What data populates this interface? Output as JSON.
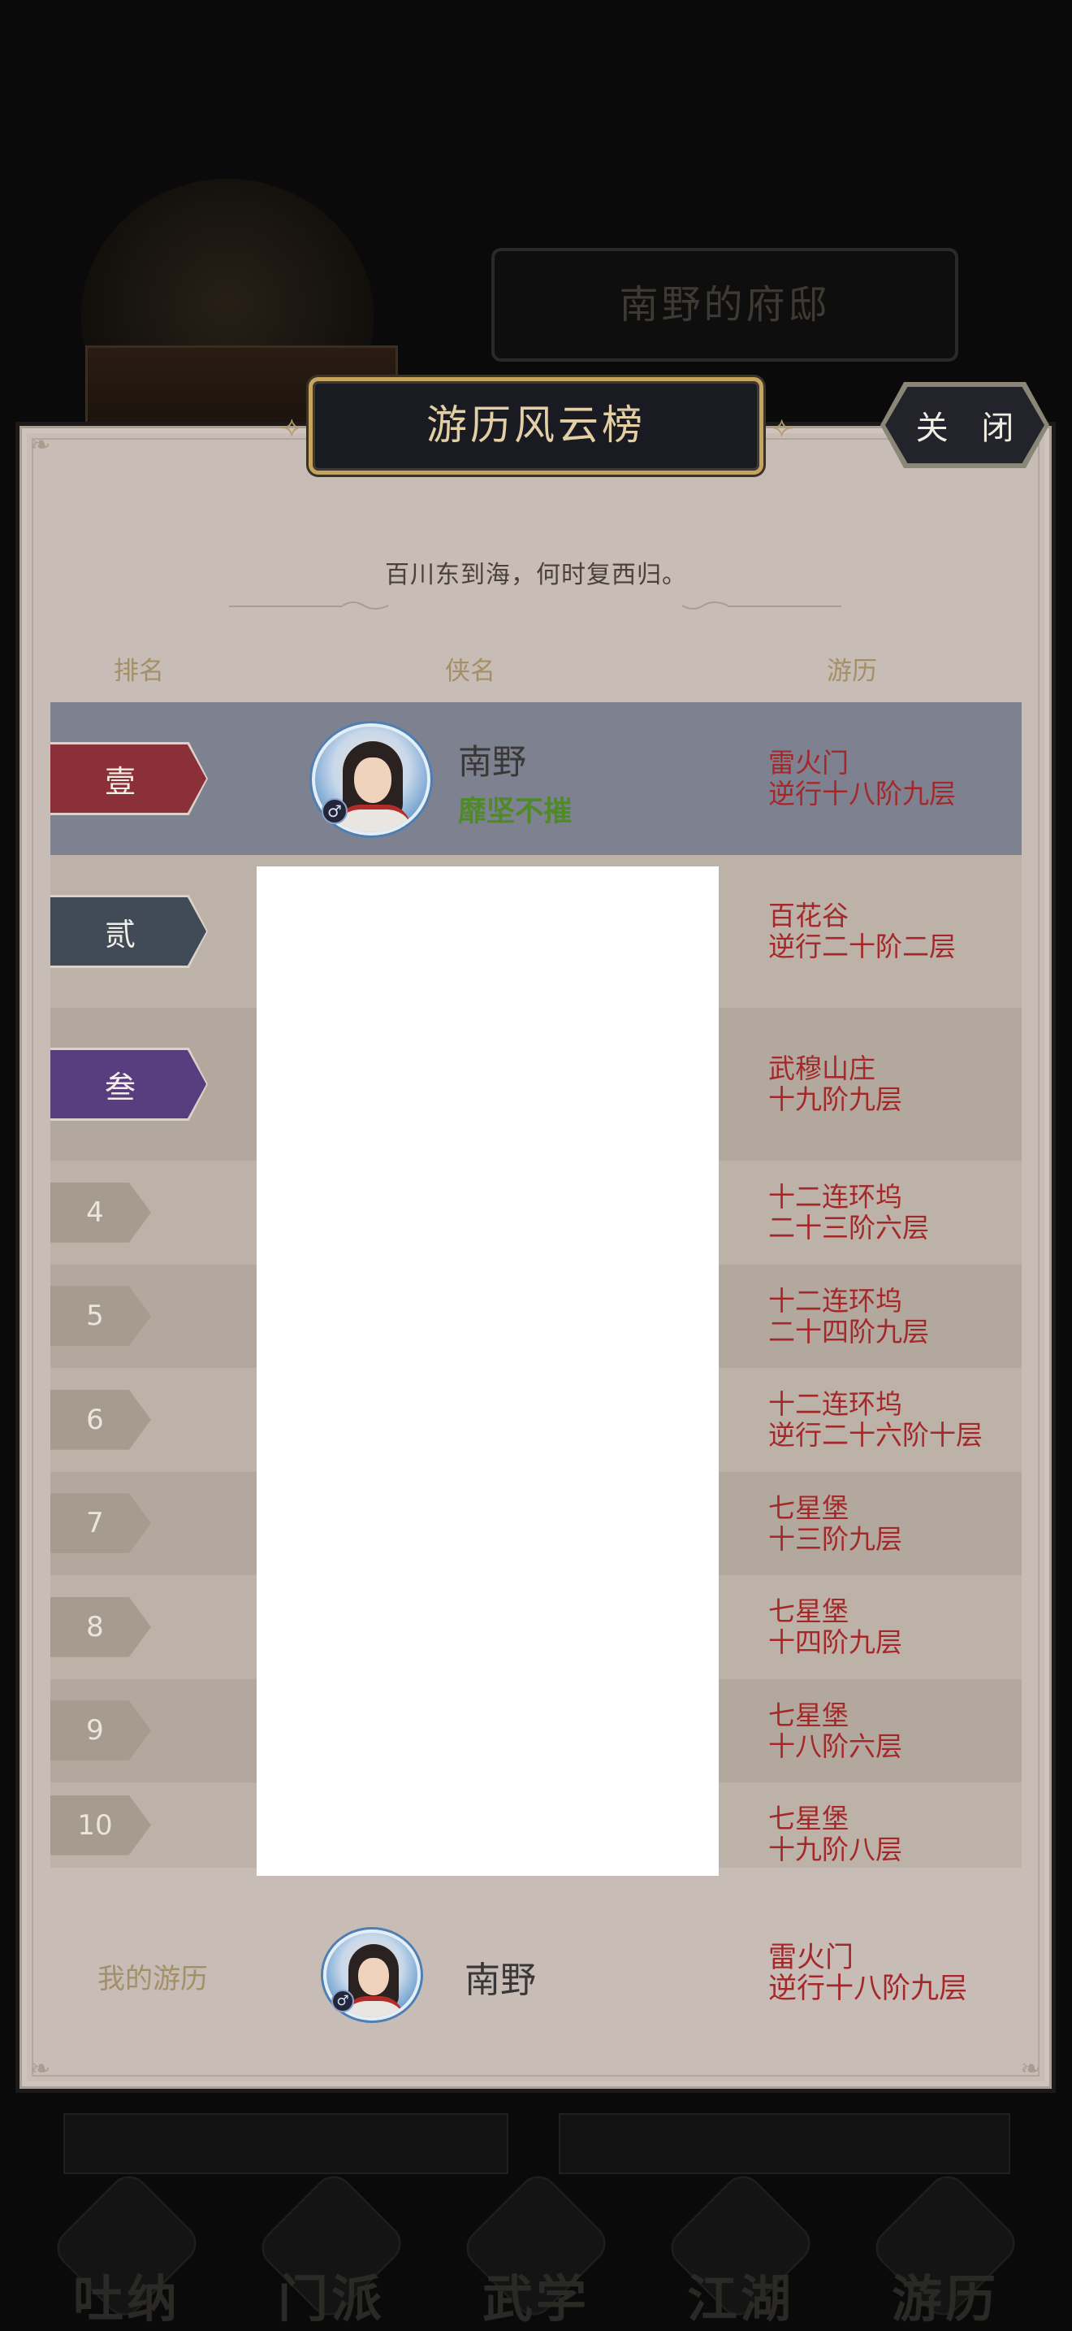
{
  "background": {
    "residence_title": "南野的府邸",
    "nav": [
      "吐纳",
      "门派",
      "武学",
      "江湖",
      "游历"
    ]
  },
  "modal": {
    "title": "游历风云榜",
    "close_label": "关 闭",
    "subtitle": "百川东到海，何时复西归。",
    "headers": {
      "rank": "排名",
      "name": "侠名",
      "travel": "游历"
    }
  },
  "rankings": [
    {
      "rank": "壹",
      "name": "南野",
      "title": "靡坚不摧",
      "sect": "雷火门",
      "stage": "逆行十八阶九层"
    },
    {
      "rank": "贰",
      "sect": "百花谷",
      "stage": "逆行二十阶二层"
    },
    {
      "rank": "叁",
      "sect": "武穆山庄",
      "stage": "十九阶九层"
    },
    {
      "rank": "4",
      "sect": "十二连环坞",
      "stage": "二十三阶六层"
    },
    {
      "rank": "5",
      "sect": "十二连环坞",
      "stage": "二十四阶九层"
    },
    {
      "rank": "6",
      "sect": "十二连环坞",
      "stage": "逆行二十六阶十层"
    },
    {
      "rank": "7",
      "sect": "七星堡",
      "stage": "十三阶九层"
    },
    {
      "rank": "8",
      "sect": "七星堡",
      "stage": "十四阶九层"
    },
    {
      "rank": "9",
      "sect": "七星堡",
      "stage": "十八阶六层"
    },
    {
      "rank": "10",
      "sect": "七星堡",
      "stage": "十九阶八层"
    }
  ],
  "my_record": {
    "label": "我的游历",
    "name": "南野",
    "sect": "雷火门",
    "stage": "逆行十八阶九层"
  },
  "icons": {
    "gender": "male-symbol-icon",
    "close": "close-button",
    "avatar": "character-portrait"
  },
  "colors": {
    "first_row_bg": "#7e8190",
    "rank1": "#8b3038",
    "rank2": "#414a57",
    "rank3": "#583e7e",
    "travel_text": "#a4282a",
    "title_green": "#4e8a27",
    "header_gold": "#a39067"
  }
}
